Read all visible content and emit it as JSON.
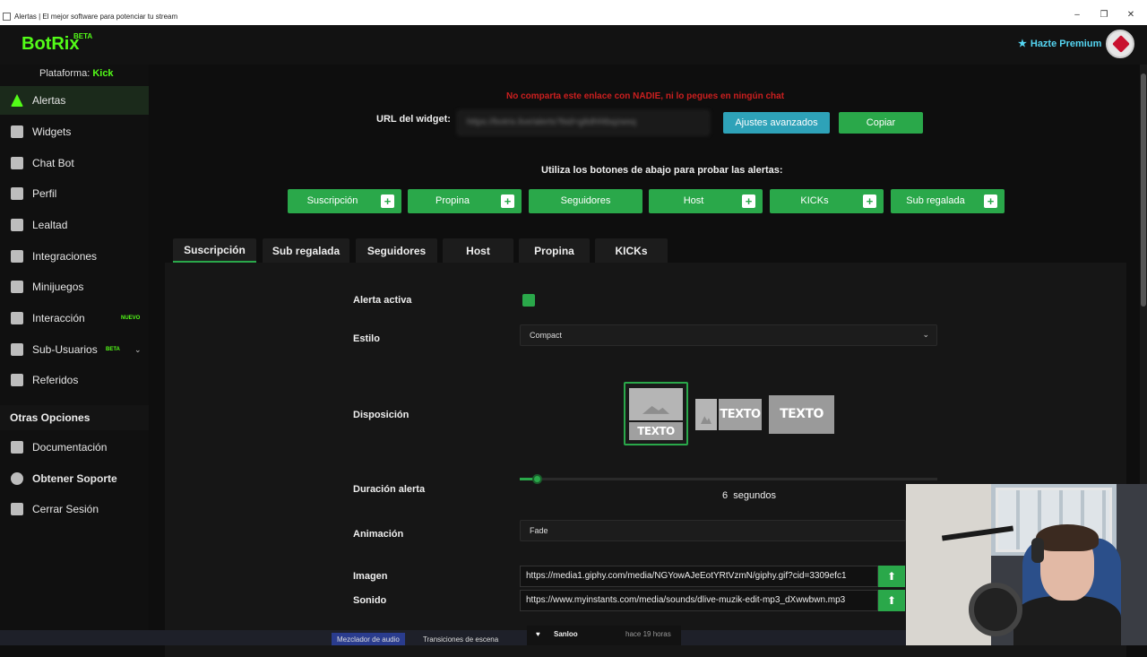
{
  "window": {
    "title": "Alertas | El mejor software para potenciar tu stream",
    "controls": [
      "–",
      "❐",
      "✕"
    ]
  },
  "header": {
    "logo": "BotRix",
    "logo_badge": "BETA",
    "premium_label": "Hazte Premium"
  },
  "sidebar": {
    "platform_label": "Plataforma:",
    "platform_value": "Kick",
    "items": [
      {
        "label": "Alertas",
        "icon": "warning-icon"
      },
      {
        "label": "Widgets",
        "icon": "grid-icon"
      },
      {
        "label": "Chat Bot",
        "icon": "robot-icon"
      },
      {
        "label": "Perfil",
        "icon": "id-card-icon"
      },
      {
        "label": "Lealtad",
        "icon": "trophy-icon"
      },
      {
        "label": "Integraciones",
        "icon": "puzzle-icon"
      },
      {
        "label": "Minijuegos",
        "icon": "gamepad-icon"
      },
      {
        "label": "Interacción",
        "icon": "music-icon",
        "badge": "NUEVO"
      },
      {
        "label": "Sub-Usuarios",
        "icon": "users-icon",
        "badge": "BETA"
      },
      {
        "label": "Referidos",
        "icon": "user-friends-icon"
      }
    ],
    "other_heading": "Otras Opciones",
    "other_items": [
      {
        "label": "Documentación",
        "icon": "book-icon"
      },
      {
        "label": "Obtener Soporte",
        "icon": "question-icon"
      },
      {
        "label": "Cerrar Sesión",
        "icon": "logout-icon"
      }
    ]
  },
  "widget": {
    "warning": "No comparta este enlace con NADIE, ni lo pegues en ningún chat",
    "url_label": "URL del widget:",
    "url_value": "https://botrix.live/alerts?bid=g8dhf4bqzwxq",
    "advanced_button": "Ajustes avanzados",
    "copy_button": "Copiar",
    "hint": "Utiliza los botones de abajo para probar las alertas:"
  },
  "test_buttons": [
    {
      "label": "Suscripción",
      "plus": "+"
    },
    {
      "label": "Propina",
      "plus": "+"
    },
    {
      "label": "Seguidores",
      "plus": ""
    },
    {
      "label": "Host",
      "plus": "+"
    },
    {
      "label": "KICKs",
      "plus": "+"
    },
    {
      "label": "Sub regalada",
      "plus": "+"
    }
  ],
  "tabs": [
    "Suscripción",
    "Sub regalada",
    "Seguidores",
    "Host",
    "Propina",
    "KICKs"
  ],
  "form": {
    "active_label": "Alerta activa",
    "style_label": "Estilo",
    "style_value": "Compact",
    "layout_label": "Disposición",
    "layout_text": "TEXTO",
    "duration_label": "Duración alerta",
    "duration_value": "6",
    "duration_unit": "segundos",
    "duration_level": 0.04,
    "animation_label": "Animación",
    "animation_value": "Fade",
    "image_label": "Imagen",
    "image_value": "https://media1.giphy.com/media/NGYowAJeEotYRtVzmN/giphy.gif?cid=3309efc1",
    "sound_label": "Sonido",
    "sound_value": "https://www.myinstants.com/media/sounds/dlive-muzik-edit-mp3_dXwwbwn.mp3"
  },
  "obs": {
    "tab_audio": "Mezclador de audio",
    "tab_transitions": "Transiciones de escena",
    "notif_user": "Sanloo",
    "notif_time": "hace 19 horas"
  },
  "colors": {
    "accent": "#2aa84a",
    "brand": "#53fc18",
    "info": "#2ea2b8",
    "warning": "#cc1f1f"
  }
}
